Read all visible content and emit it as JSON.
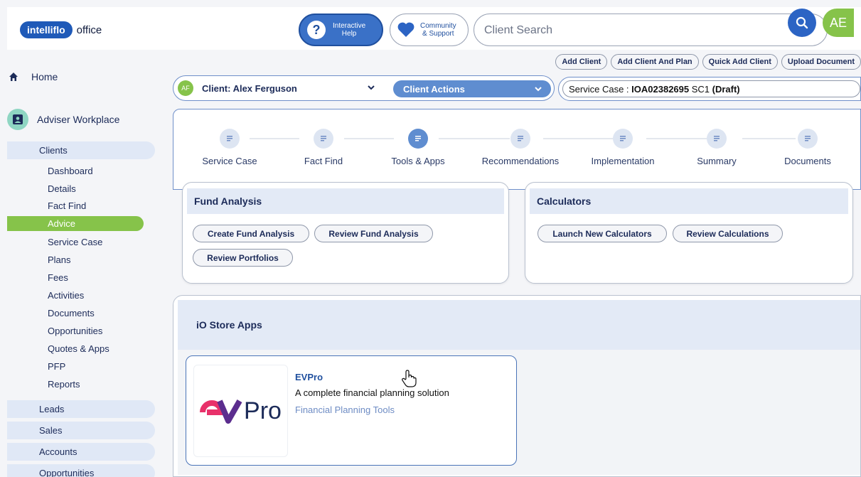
{
  "header": {
    "logo_brand": "intelliflo",
    "logo_product": "office",
    "help_label_1": "Interactive",
    "help_label_2": "Help",
    "community_label_1": "Community",
    "community_label_2": "& Support",
    "search_placeholder": "Client Search",
    "user_initials": "AE"
  },
  "actions": [
    "Add Client",
    "Add Client And Plan",
    "Quick Add Client",
    "Upload Document"
  ],
  "sidebar": {
    "home": "Home",
    "workplace": "Adviser Workplace",
    "clients": "Clients",
    "client_items": [
      "Dashboard",
      "Details",
      "Fact Find",
      "Advice",
      "Service Case",
      "Plans",
      "Fees",
      "Activities",
      "Documents",
      "Opportunities",
      "Quotes & Apps",
      "PFP",
      "Reports"
    ],
    "active_item": "Advice",
    "bottom_items": [
      "Leads",
      "Sales",
      "Accounts",
      "Opportunities"
    ]
  },
  "client_bar": {
    "initials": "AF",
    "client_label": "Client: Alex Ferguson",
    "actions_label": "Client Actions",
    "service_case_prefix": "Service Case : ",
    "service_case_id": "IOA02382695",
    "service_case_suffix": " SC1 ",
    "service_case_status": "(Draft)"
  },
  "steps": [
    "Service Case",
    "Fact Find",
    "Tools & Apps",
    "Recommendations",
    "Implementation",
    "Summary",
    "Documents"
  ],
  "active_step": "Tools & Apps",
  "fund_analysis": {
    "title": "Fund Analysis",
    "buttons": [
      "Create Fund Analysis",
      "Review Fund Analysis",
      "Review Portfolios"
    ]
  },
  "calculators": {
    "title": "Calculators",
    "buttons": [
      "Launch New Calculators",
      "Review Calculations"
    ]
  },
  "store": {
    "title": "iO Store Apps",
    "app": {
      "logo_text": "Pro",
      "name": "EVPro",
      "description": "A complete financial planning solution",
      "category": "Financial Planning Tools"
    }
  },
  "colors": {
    "brand_blue": "#1f5ab8",
    "accent_green": "#86c34a",
    "evpro_pink": "#e8316a",
    "evpro_purple": "#5b2d8e"
  }
}
